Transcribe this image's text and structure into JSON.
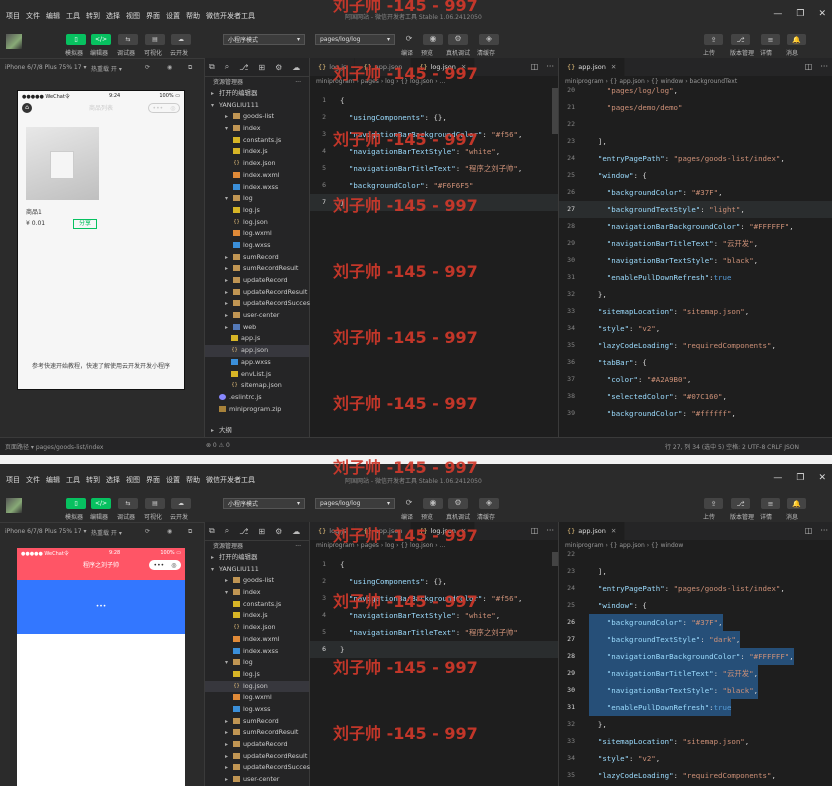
{
  "menu": [
    "项目",
    "文件",
    "编辑",
    "工具",
    "转到",
    "选择",
    "视图",
    "界面",
    "设置",
    "帮助",
    "微信开发者工具"
  ],
  "window_title": "阿国网站 - 微信开发者工具 Stable 1.06.2412050",
  "toolbar": {
    "buttons": [
      {
        "label": "模拟器",
        "icon": "▯",
        "green": true
      },
      {
        "label": "编辑器",
        "icon": "</>",
        "green": true
      },
      {
        "label": "调试器",
        "icon": "⇆",
        "green": false
      },
      {
        "label": "可视化",
        "icon": "▤",
        "green": false
      },
      {
        "label": "云开发",
        "icon": "☁",
        "green": false
      }
    ],
    "mode_select": "小程序模式",
    "page_select": "pages/log/log",
    "actions": [
      {
        "label": "编译",
        "icon": "⟳"
      },
      {
        "label": "预览",
        "icon": "◉"
      },
      {
        "label": "真机调试",
        "icon": "⚙"
      },
      {
        "label": "清缓存",
        "icon": "◈"
      }
    ],
    "right": [
      {
        "label": "上传",
        "icon": "⇪"
      },
      {
        "label": "版本管理",
        "icon": "⎇"
      },
      {
        "label": "详情",
        "icon": "≡"
      },
      {
        "label": "消息",
        "icon": "🔔"
      }
    ]
  },
  "simbar": {
    "device": "iPhone 6/7/8 Plus 75% 17 ▾",
    "hotreload": "热重载 开 ▾"
  },
  "panel1": {
    "phone": {
      "carrier": "●●●●● WeChat令",
      "time": "9:24",
      "battery": "100% ▭",
      "nav_title": "商品列表",
      "product_name": "商品1",
      "price": "¥ 0.01",
      "share": "分享",
      "footer": "参考快速开始教程，快速了解使用云开发开发小程序"
    },
    "tabs_mid": [
      {
        "name": "log.js",
        "active": false
      },
      {
        "name": "app.json",
        "active": false
      },
      {
        "name": "log.json",
        "active": true
      }
    ],
    "crumbs_mid": "miniprogram › pages › log › {} log.json › ...",
    "tabs_right": [
      {
        "name": "app.json",
        "active": true
      }
    ],
    "crumbs_right": "miniprogram › {} app.json › {} window › backgroundText",
    "status_left": "页面路径 ▾   pages/goods-list/index",
    "status_mid": "⊗ 0 ⚠ 0",
    "status_right": "行 27, 列 34 (选中 5)  空格: 2  UTF-8  CRLF  JSON"
  },
  "panel2": {
    "phone": {
      "carrier": "●●●●● WeChat令",
      "time": "9:28",
      "battery": "100% ▭",
      "nav_title": "程序之刘子帅",
      "dots": "•••"
    },
    "tabs_mid": [
      {
        "name": "log.js",
        "active": false
      },
      {
        "name": "app.json",
        "active": false
      },
      {
        "name": "log.json",
        "active": true
      }
    ],
    "crumbs_mid": "miniprogram › pages › log › {} log.json › ...",
    "tabs_right": [
      {
        "name": "app.json",
        "active": true
      }
    ],
    "crumbs_right": "miniprogram › {} app.json › {} window"
  },
  "explorer": {
    "header": "资源管理器",
    "open_editors": "打开的编辑器",
    "project": "YANGLIU111",
    "outline": "大纲"
  },
  "tree1": [
    {
      "d": 1,
      "t": "folder",
      "a": "▸",
      "n": "goods-list"
    },
    {
      "d": 1,
      "t": "folder",
      "a": "▾",
      "n": "index"
    },
    {
      "d": 2,
      "t": "js",
      "n": "constants.js"
    },
    {
      "d": 2,
      "t": "js",
      "n": "index.js"
    },
    {
      "d": 2,
      "t": "json",
      "n": "index.json"
    },
    {
      "d": 2,
      "t": "wxml",
      "n": "index.wxml"
    },
    {
      "d": 2,
      "t": "wxss",
      "n": "index.wxss"
    },
    {
      "d": 1,
      "t": "folder",
      "a": "▾",
      "n": "log"
    },
    {
      "d": 2,
      "t": "js",
      "n": "log.js"
    },
    {
      "d": 2,
      "t": "json",
      "n": "log.json"
    },
    {
      "d": 2,
      "t": "wxml",
      "n": "log.wxml"
    },
    {
      "d": 2,
      "t": "wxss",
      "n": "log.wxss"
    },
    {
      "d": 1,
      "t": "folder",
      "a": "▸",
      "n": "sumRecord"
    },
    {
      "d": 1,
      "t": "folder",
      "a": "▸",
      "n": "sumRecordResult"
    },
    {
      "d": 1,
      "t": "folder",
      "a": "▸",
      "n": "updateRecord"
    },
    {
      "d": 1,
      "t": "folder",
      "a": "▸",
      "n": "updateRecordResult"
    },
    {
      "d": 1,
      "t": "folder",
      "a": "▸",
      "n": "updateRecordSuccess"
    },
    {
      "d": 1,
      "t": "folder",
      "a": "▸",
      "n": "user-center"
    },
    {
      "d": 1,
      "t": "folderb",
      "a": "▸",
      "n": "web"
    },
    {
      "d": 0,
      "t": "js",
      "n": "app.js"
    },
    {
      "d": 0,
      "t": "json",
      "n": "app.json",
      "sel": true
    },
    {
      "d": 0,
      "t": "wxss",
      "n": "app.wxss"
    },
    {
      "d": 0,
      "t": "js",
      "n": "envList.js"
    },
    {
      "d": 0,
      "t": "json",
      "n": "sitemap.json"
    },
    {
      "d": -1,
      "t": "gear",
      "n": ".eslintrc.js"
    },
    {
      "d": -1,
      "t": "zip",
      "n": "miniprogram.zip"
    }
  ],
  "tree2": [
    {
      "d": 1,
      "t": "folder",
      "a": "▸",
      "n": "goods-list"
    },
    {
      "d": 1,
      "t": "folder",
      "a": "▾",
      "n": "index"
    },
    {
      "d": 2,
      "t": "js",
      "n": "constants.js"
    },
    {
      "d": 2,
      "t": "js",
      "n": "index.js"
    },
    {
      "d": 2,
      "t": "json",
      "n": "index.json"
    },
    {
      "d": 2,
      "t": "wxml",
      "n": "index.wxml"
    },
    {
      "d": 2,
      "t": "wxss",
      "n": "index.wxss"
    },
    {
      "d": 1,
      "t": "folder",
      "a": "▾",
      "n": "log"
    },
    {
      "d": 2,
      "t": "js",
      "n": "log.js"
    },
    {
      "d": 2,
      "t": "json",
      "n": "log.json",
      "sel": true
    },
    {
      "d": 2,
      "t": "wxml",
      "n": "log.wxml"
    },
    {
      "d": 2,
      "t": "wxss",
      "n": "log.wxss"
    },
    {
      "d": 1,
      "t": "folder",
      "a": "▸",
      "n": "sumRecord"
    },
    {
      "d": 1,
      "t": "folder",
      "a": "▸",
      "n": "sumRecordResult"
    },
    {
      "d": 1,
      "t": "folder",
      "a": "▸",
      "n": "updateRecord"
    },
    {
      "d": 1,
      "t": "folder",
      "a": "▸",
      "n": "updateRecordResult"
    },
    {
      "d": 1,
      "t": "folder",
      "a": "▸",
      "n": "updateRecordSuccess"
    },
    {
      "d": 1,
      "t": "folder",
      "a": "▸",
      "n": "user-center"
    }
  ],
  "code_mid1": [
    {
      "n": "1",
      "t": [
        [
          "pun",
          "{"
        ]
      ]
    },
    {
      "n": "2",
      "t": [
        [
          "key",
          "  \"usingComponents\""
        ],
        [
          "pun",
          ": {},"
        ]
      ]
    },
    {
      "n": "3",
      "t": [
        [
          "key",
          "  \"navigationBarBackgroundColor\""
        ],
        [
          "pun",
          ": "
        ],
        [
          "str",
          "\"#f56\""
        ],
        [
          "pun",
          ","
        ]
      ]
    },
    {
      "n": "4",
      "t": [
        [
          "key",
          "  \"navigationBarTextStyle\""
        ],
        [
          "pun",
          ": "
        ],
        [
          "str",
          "\"white\""
        ],
        [
          "pun",
          ","
        ]
      ]
    },
    {
      "n": "5",
      "t": [
        [
          "key",
          "  \"navigationBarTitleText\""
        ],
        [
          "pun",
          ": "
        ],
        [
          "str",
          "\"程序之刘子帅\""
        ],
        [
          "pun",
          ","
        ]
      ]
    },
    {
      "n": "6",
      "t": [
        [
          "key",
          "  \"backgroundColor\""
        ],
        [
          "pun",
          ": "
        ],
        [
          "str",
          "\"#F6F6F5\""
        ]
      ]
    },
    {
      "n": "7",
      "t": [
        [
          "pun",
          "}"
        ]
      ],
      "hl": true
    }
  ],
  "code_right1": [
    {
      "n": "20",
      "t": [
        [
          "str",
          "    \"pages/log/log\""
        ],
        [
          "pun",
          ","
        ]
      ]
    },
    {
      "n": "21",
      "t": [
        [
          "str",
          "    \"pages/demo/demo\""
        ]
      ]
    },
    {
      "n": "22",
      "t": [
        [
          "pun",
          ""
        ]
      ]
    },
    {
      "n": "23",
      "t": [
        [
          "pun",
          "  ],"
        ]
      ]
    },
    {
      "n": "24",
      "t": [
        [
          "key",
          "  \"entryPagePath\""
        ],
        [
          "pun",
          ": "
        ],
        [
          "str",
          "\"pages/goods-list/index\""
        ],
        [
          "pun",
          ","
        ]
      ]
    },
    {
      "n": "25",
      "t": [
        [
          "key",
          "  \"window\""
        ],
        [
          "pun",
          ": {"
        ]
      ]
    },
    {
      "n": "26",
      "t": [
        [
          "key",
          "    \"backgroundColor\""
        ],
        [
          "pun",
          ": "
        ],
        [
          "str",
          "\"#37F\""
        ],
        [
          "pun",
          ","
        ]
      ]
    },
    {
      "n": "27",
      "t": [
        [
          "key",
          "    \"backgroundTextStyle\""
        ],
        [
          "pun",
          ": "
        ],
        [
          "str",
          "\"light\""
        ],
        [
          "pun",
          ","
        ]
      ],
      "hl": true
    },
    {
      "n": "28",
      "t": [
        [
          "key",
          "    \"navigationBarBackgroundColor\""
        ],
        [
          "pun",
          ": "
        ],
        [
          "str",
          "\"#FFFFFF\""
        ],
        [
          "pun",
          ","
        ]
      ]
    },
    {
      "n": "29",
      "t": [
        [
          "key",
          "    \"navigationBarTitleText\""
        ],
        [
          "pun",
          ": "
        ],
        [
          "str",
          "\"云开发\""
        ],
        [
          "pun",
          ","
        ]
      ]
    },
    {
      "n": "30",
      "t": [
        [
          "key",
          "    \"navigationBarTextStyle\""
        ],
        [
          "pun",
          ": "
        ],
        [
          "str",
          "\"black\""
        ],
        [
          "pun",
          ","
        ]
      ]
    },
    {
      "n": "31",
      "t": [
        [
          "key",
          "    \"enablePullDownRefresh\""
        ],
        [
          "pun",
          ":"
        ],
        [
          "kw",
          "true"
        ]
      ]
    },
    {
      "n": "32",
      "t": [
        [
          "pun",
          "  },"
        ]
      ]
    },
    {
      "n": "33",
      "t": [
        [
          "key",
          "  \"sitemapLocation\""
        ],
        [
          "pun",
          ": "
        ],
        [
          "str",
          "\"sitemap.json\""
        ],
        [
          "pun",
          ","
        ]
      ]
    },
    {
      "n": "34",
      "t": [
        [
          "key",
          "  \"style\""
        ],
        [
          "pun",
          ": "
        ],
        [
          "str",
          "\"v2\""
        ],
        [
          "pun",
          ","
        ]
      ]
    },
    {
      "n": "35",
      "t": [
        [
          "key",
          "  \"lazyCodeLoading\""
        ],
        [
          "pun",
          ": "
        ],
        [
          "str",
          "\"requiredComponents\""
        ],
        [
          "pun",
          ","
        ]
      ]
    },
    {
      "n": "36",
      "t": [
        [
          "key",
          "  \"tabBar\""
        ],
        [
          "pun",
          ": {"
        ]
      ]
    },
    {
      "n": "37",
      "t": [
        [
          "key",
          "    \"color\""
        ],
        [
          "pun",
          ": "
        ],
        [
          "str",
          "\"#A2A9B0\""
        ],
        [
          "pun",
          ","
        ]
      ]
    },
    {
      "n": "38",
      "t": [
        [
          "key",
          "    \"selectedColor\""
        ],
        [
          "pun",
          ": "
        ],
        [
          "str",
          "\"#07C160\""
        ],
        [
          "pun",
          ","
        ]
      ]
    },
    {
      "n": "39",
      "t": [
        [
          "key",
          "    \"backgroundColor\""
        ],
        [
          "pun",
          ": "
        ],
        [
          "str",
          "\"#ffffff\""
        ],
        [
          "pun",
          ","
        ]
      ]
    }
  ],
  "code_mid2": [
    {
      "n": "1",
      "t": [
        [
          "pun",
          "{"
        ]
      ]
    },
    {
      "n": "2",
      "t": [
        [
          "key",
          "  \"usingComponents\""
        ],
        [
          "pun",
          ": {},"
        ]
      ]
    },
    {
      "n": "3",
      "t": [
        [
          "key",
          "  \"navigationBarBackgroundColor\""
        ],
        [
          "pun",
          ": "
        ],
        [
          "str",
          "\"#f56\""
        ],
        [
          "pun",
          ","
        ]
      ]
    },
    {
      "n": "4",
      "t": [
        [
          "key",
          "  \"navigationBarTextStyle\""
        ],
        [
          "pun",
          ": "
        ],
        [
          "str",
          "\"white\""
        ],
        [
          "pun",
          ","
        ]
      ]
    },
    {
      "n": "5",
      "t": [
        [
          "key",
          "  \"navigationBarTitleText\""
        ],
        [
          "pun",
          ": "
        ],
        [
          "str",
          "\"程序之刘子帅\""
        ]
      ]
    },
    {
      "n": "6",
      "t": [
        [
          "pun",
          "}"
        ]
      ],
      "hl": true
    }
  ],
  "code_right2": [
    {
      "n": "22",
      "t": [
        [
          "pun",
          ""
        ]
      ]
    },
    {
      "n": "23",
      "t": [
        [
          "pun",
          "  ],"
        ]
      ]
    },
    {
      "n": "24",
      "t": [
        [
          "key",
          "  \"entryPagePath\""
        ],
        [
          "pun",
          ": "
        ],
        [
          "str",
          "\"pages/goods-list/index\""
        ],
        [
          "pun",
          ","
        ]
      ]
    },
    {
      "n": "25",
      "t": [
        [
          "key",
          "  \"window\""
        ],
        [
          "pun",
          ": {"
        ]
      ]
    },
    {
      "n": "26",
      "t": [
        [
          "key",
          "    \"backgroundColor\""
        ],
        [
          "pun",
          ": "
        ],
        [
          "str",
          "\"#37F\""
        ],
        [
          "pun",
          ","
        ]
      ],
      "sel": true
    },
    {
      "n": "27",
      "t": [
        [
          "key",
          "    \"backgroundTextStyle\""
        ],
        [
          "pun",
          ": "
        ],
        [
          "str",
          "\"dark\""
        ],
        [
          "pun",
          ","
        ]
      ],
      "sel": true
    },
    {
      "n": "28",
      "t": [
        [
          "key",
          "    \"navigationBarBackgroundColor\""
        ],
        [
          "pun",
          ": "
        ],
        [
          "str",
          "\"#FFFFFF\""
        ],
        [
          "pun",
          ","
        ]
      ],
      "sel": true
    },
    {
      "n": "29",
      "t": [
        [
          "key",
          "    \"navigationBarTitleText\""
        ],
        [
          "pun",
          ": "
        ],
        [
          "str",
          "\"云开发\""
        ],
        [
          "pun",
          ","
        ]
      ],
      "sel": true
    },
    {
      "n": "30",
      "t": [
        [
          "key",
          "    \"navigationBarTextStyle\""
        ],
        [
          "pun",
          ": "
        ],
        [
          "str",
          "\"black\""
        ],
        [
          "pun",
          ","
        ]
      ],
      "sel": true
    },
    {
      "n": "31",
      "t": [
        [
          "key",
          "    \"enablePullDownRefresh\""
        ],
        [
          "pun",
          ":"
        ],
        [
          "kw",
          "true"
        ]
      ],
      "sel": true
    },
    {
      "n": "32",
      "t": [
        [
          "pun",
          "  },"
        ]
      ]
    },
    {
      "n": "33",
      "t": [
        [
          "key",
          "  \"sitemapLocation\""
        ],
        [
          "pun",
          ": "
        ],
        [
          "str",
          "\"sitemap.json\""
        ],
        [
          "pun",
          ","
        ]
      ]
    },
    {
      "n": "34",
      "t": [
        [
          "key",
          "  \"style\""
        ],
        [
          "pun",
          ": "
        ],
        [
          "str",
          "\"v2\""
        ],
        [
          "pun",
          ","
        ]
      ]
    },
    {
      "n": "35",
      "t": [
        [
          "key",
          "  \"lazyCodeLoading\""
        ],
        [
          "pun",
          ": "
        ],
        [
          "str",
          "\"requiredComponents\""
        ],
        [
          "pun",
          ","
        ]
      ]
    }
  ],
  "watermark": "刘子帅 -145 - 997",
  "colors": {
    "accent": "#07c160",
    "phone2_nav": "#ff5566",
    "phone2_body": "#3377ff",
    "watermark": "#d0392b"
  }
}
